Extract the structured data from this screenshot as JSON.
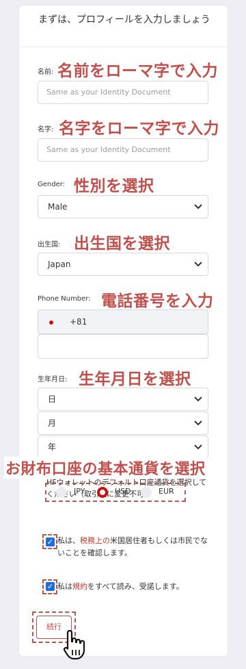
{
  "form": {
    "title": "まずは、プロフィールを入力しましょう",
    "first_name_label": "名前:",
    "first_name_placeholder": "Same as your Identity Document",
    "last_name_label": "名字:",
    "last_name_placeholder": "Same as your Identity Document",
    "gender_label": "Gender:",
    "gender_value": "Male",
    "country_label": "出生国:",
    "country_value": "Japan",
    "phone_label": "Phone Number:",
    "phone_code": "+81",
    "phone_value": "",
    "dob_label": "生年月日:",
    "dob_day": "日",
    "dob_month": "月",
    "dob_year": "年",
    "currency_text": "HFウォレットのデフォルト口座通貨を選択してください（取引後に変更不可）",
    "currencies": [
      "JPY",
      "USD",
      "EUR"
    ],
    "currency_selected": "USD",
    "check1_pre": "私は、",
    "check1_link": "税務上の",
    "check1_post": "米国居住者もしくは市民でないことを確認します。",
    "check2_pre": "私は",
    "check2_link": "規約",
    "check2_post": "をすべて読み、受諾します。",
    "submit_label": "続行"
  },
  "annotations": {
    "first_name": "名前をローマ字で入力",
    "last_name": "名字をローマ字で入力",
    "gender": "性別を選択",
    "country": "出生国を選択",
    "phone": "電話番号を入力",
    "dob": "生年月日を選択",
    "currency": "お財布口座の基本通貨を選択"
  },
  "colors": {
    "annotation": "#c0504d",
    "accent_red": "#cc1010",
    "checkbox_blue": "#1e6fd9",
    "background": "#eeeef4"
  }
}
